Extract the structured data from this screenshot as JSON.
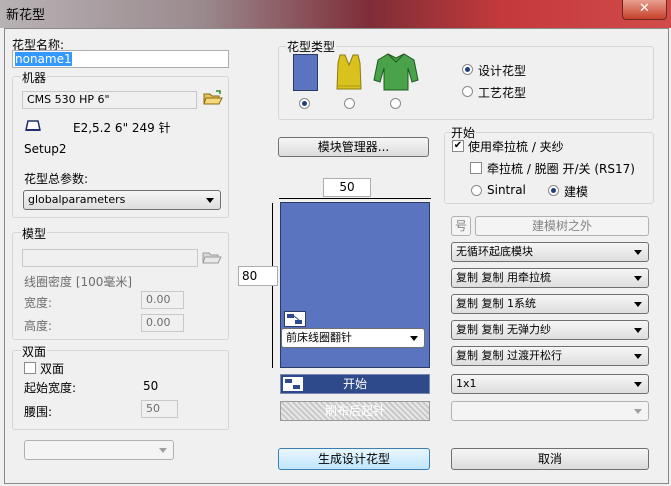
{
  "window": {
    "title": "新花型",
    "close": "✕"
  },
  "pattern_name": {
    "label": "花型名称:",
    "value": "noname1"
  },
  "machine": {
    "label": "机器",
    "name": "CMS 530 HP 6\"",
    "spec": "E2,5.2  6\"  249 针",
    "setup": "Setup2"
  },
  "pattern_params": {
    "label": "花型总参数:",
    "value": "globalparameters"
  },
  "model": {
    "label": "模型",
    "density_label": "线圈密度 [100毫米]",
    "width_label": "宽度:",
    "width_value": "0.00",
    "height_label": "高度:",
    "height_value": "0.00"
  },
  "double": {
    "label": "双面",
    "checkbox_label": "双面",
    "start_width_label": "起始宽度:",
    "start_width_value": "50",
    "waist_label": "腰围:",
    "waist_value": "50"
  },
  "pattern_type": {
    "label": "花型类型",
    "options": [
      {
        "label": "设计花型",
        "selected": true
      },
      {
        "label": "工艺花型",
        "selected": false
      }
    ]
  },
  "module_manager_label": "模块管理器...",
  "canvas": {
    "width": "50",
    "height": "80",
    "knit_select": "前床线圈翻针",
    "start_label": "开始",
    "after_brush_label": "刷布后起针"
  },
  "start_group": {
    "label": "开始",
    "use_comb_label": "使用牵拉梳 / 夹纱",
    "use_comb_checked": true,
    "comb_toggle_label": "牵拉梳 / 脱圈 开/关 (RS17)",
    "comb_toggle_checked": false,
    "sintral_label": "Sintral",
    "model_label": "建模",
    "model_selected": true,
    "num_label": "号",
    "outside_tree_label": "建模树之外",
    "selects": [
      "无循环起底模块",
      "复制 复制 用牵拉梳",
      "复制 复制 1系统",
      "复制 复制 无弹力纱",
      "复制 复制 过渡开松行",
      "1x1"
    ]
  },
  "generate_label": "生成设计花型",
  "cancel_label": "取消",
  "colors": {
    "canvas_blue": "#5a74bf",
    "vest_yellow": "#d9c21e",
    "sweater_green": "#4aa24a"
  }
}
